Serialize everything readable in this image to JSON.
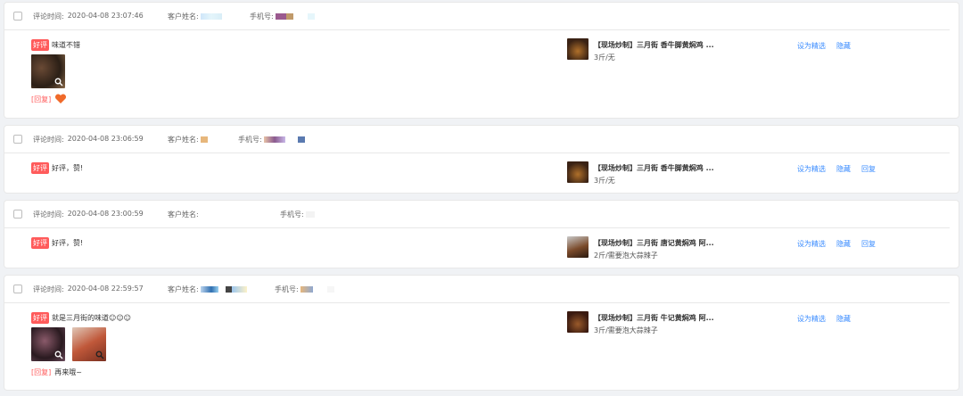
{
  "reviews": [
    {
      "time_label": "评论时间:",
      "time": "2020-04-08 23:07:46",
      "name_label": "客户姓名:",
      "phone_label": "手机号:",
      "badge": "好评",
      "text": "味道不错",
      "images": 1,
      "reply_tag": "[回复]",
      "reply_text": "",
      "reply_emoji": "heart-icon",
      "product_title": "【现场炒制】三月街 香牛脚黄焖鸡 ...",
      "product_spec": "3斤/无",
      "actions": [
        "设为精选",
        "隐藏"
      ]
    },
    {
      "time_label": "评论时间:",
      "time": "2020-04-08 23:06:59",
      "name_label": "客户姓名:",
      "phone_label": "手机号:",
      "badge": "好评",
      "text": "好评，赞!",
      "images": 0,
      "product_title": "【现场炒制】三月街 香牛脚黄焖鸡 ...",
      "product_spec": "3斤/无",
      "actions": [
        "设为精选",
        "隐藏",
        "回复"
      ]
    },
    {
      "time_label": "评论时间:",
      "time": "2020-04-08 23:00:59",
      "name_label": "客户姓名:",
      "phone_label": "手机号:",
      "badge": "好评",
      "text": "好评，赞!",
      "images": 0,
      "product_title": "【现场炒制】三月街 唐记黄焖鸡 阿...",
      "product_spec": "2斤/需要泡大蒜辣子",
      "actions": [
        "设为精选",
        "隐藏",
        "回复"
      ]
    },
    {
      "time_label": "评论时间:",
      "time": "2020-04-08 22:59:57",
      "name_label": "客户姓名:",
      "phone_label": "手机号:",
      "badge": "好评",
      "text": "就是三月街的味道☺☺☺",
      "images": 2,
      "reply_tag": "[回复]",
      "reply_text": "再来哦~",
      "product_title": "【现场炒制】三月街 牛记黄焖鸡 阿...",
      "product_spec": "3斤/需要泡大蒜辣子",
      "actions": [
        "设为精选",
        "隐藏"
      ]
    }
  ],
  "colors": {
    "badge": "#ff5b5b",
    "link": "#3b8cff",
    "background": "#f0f2f5"
  }
}
